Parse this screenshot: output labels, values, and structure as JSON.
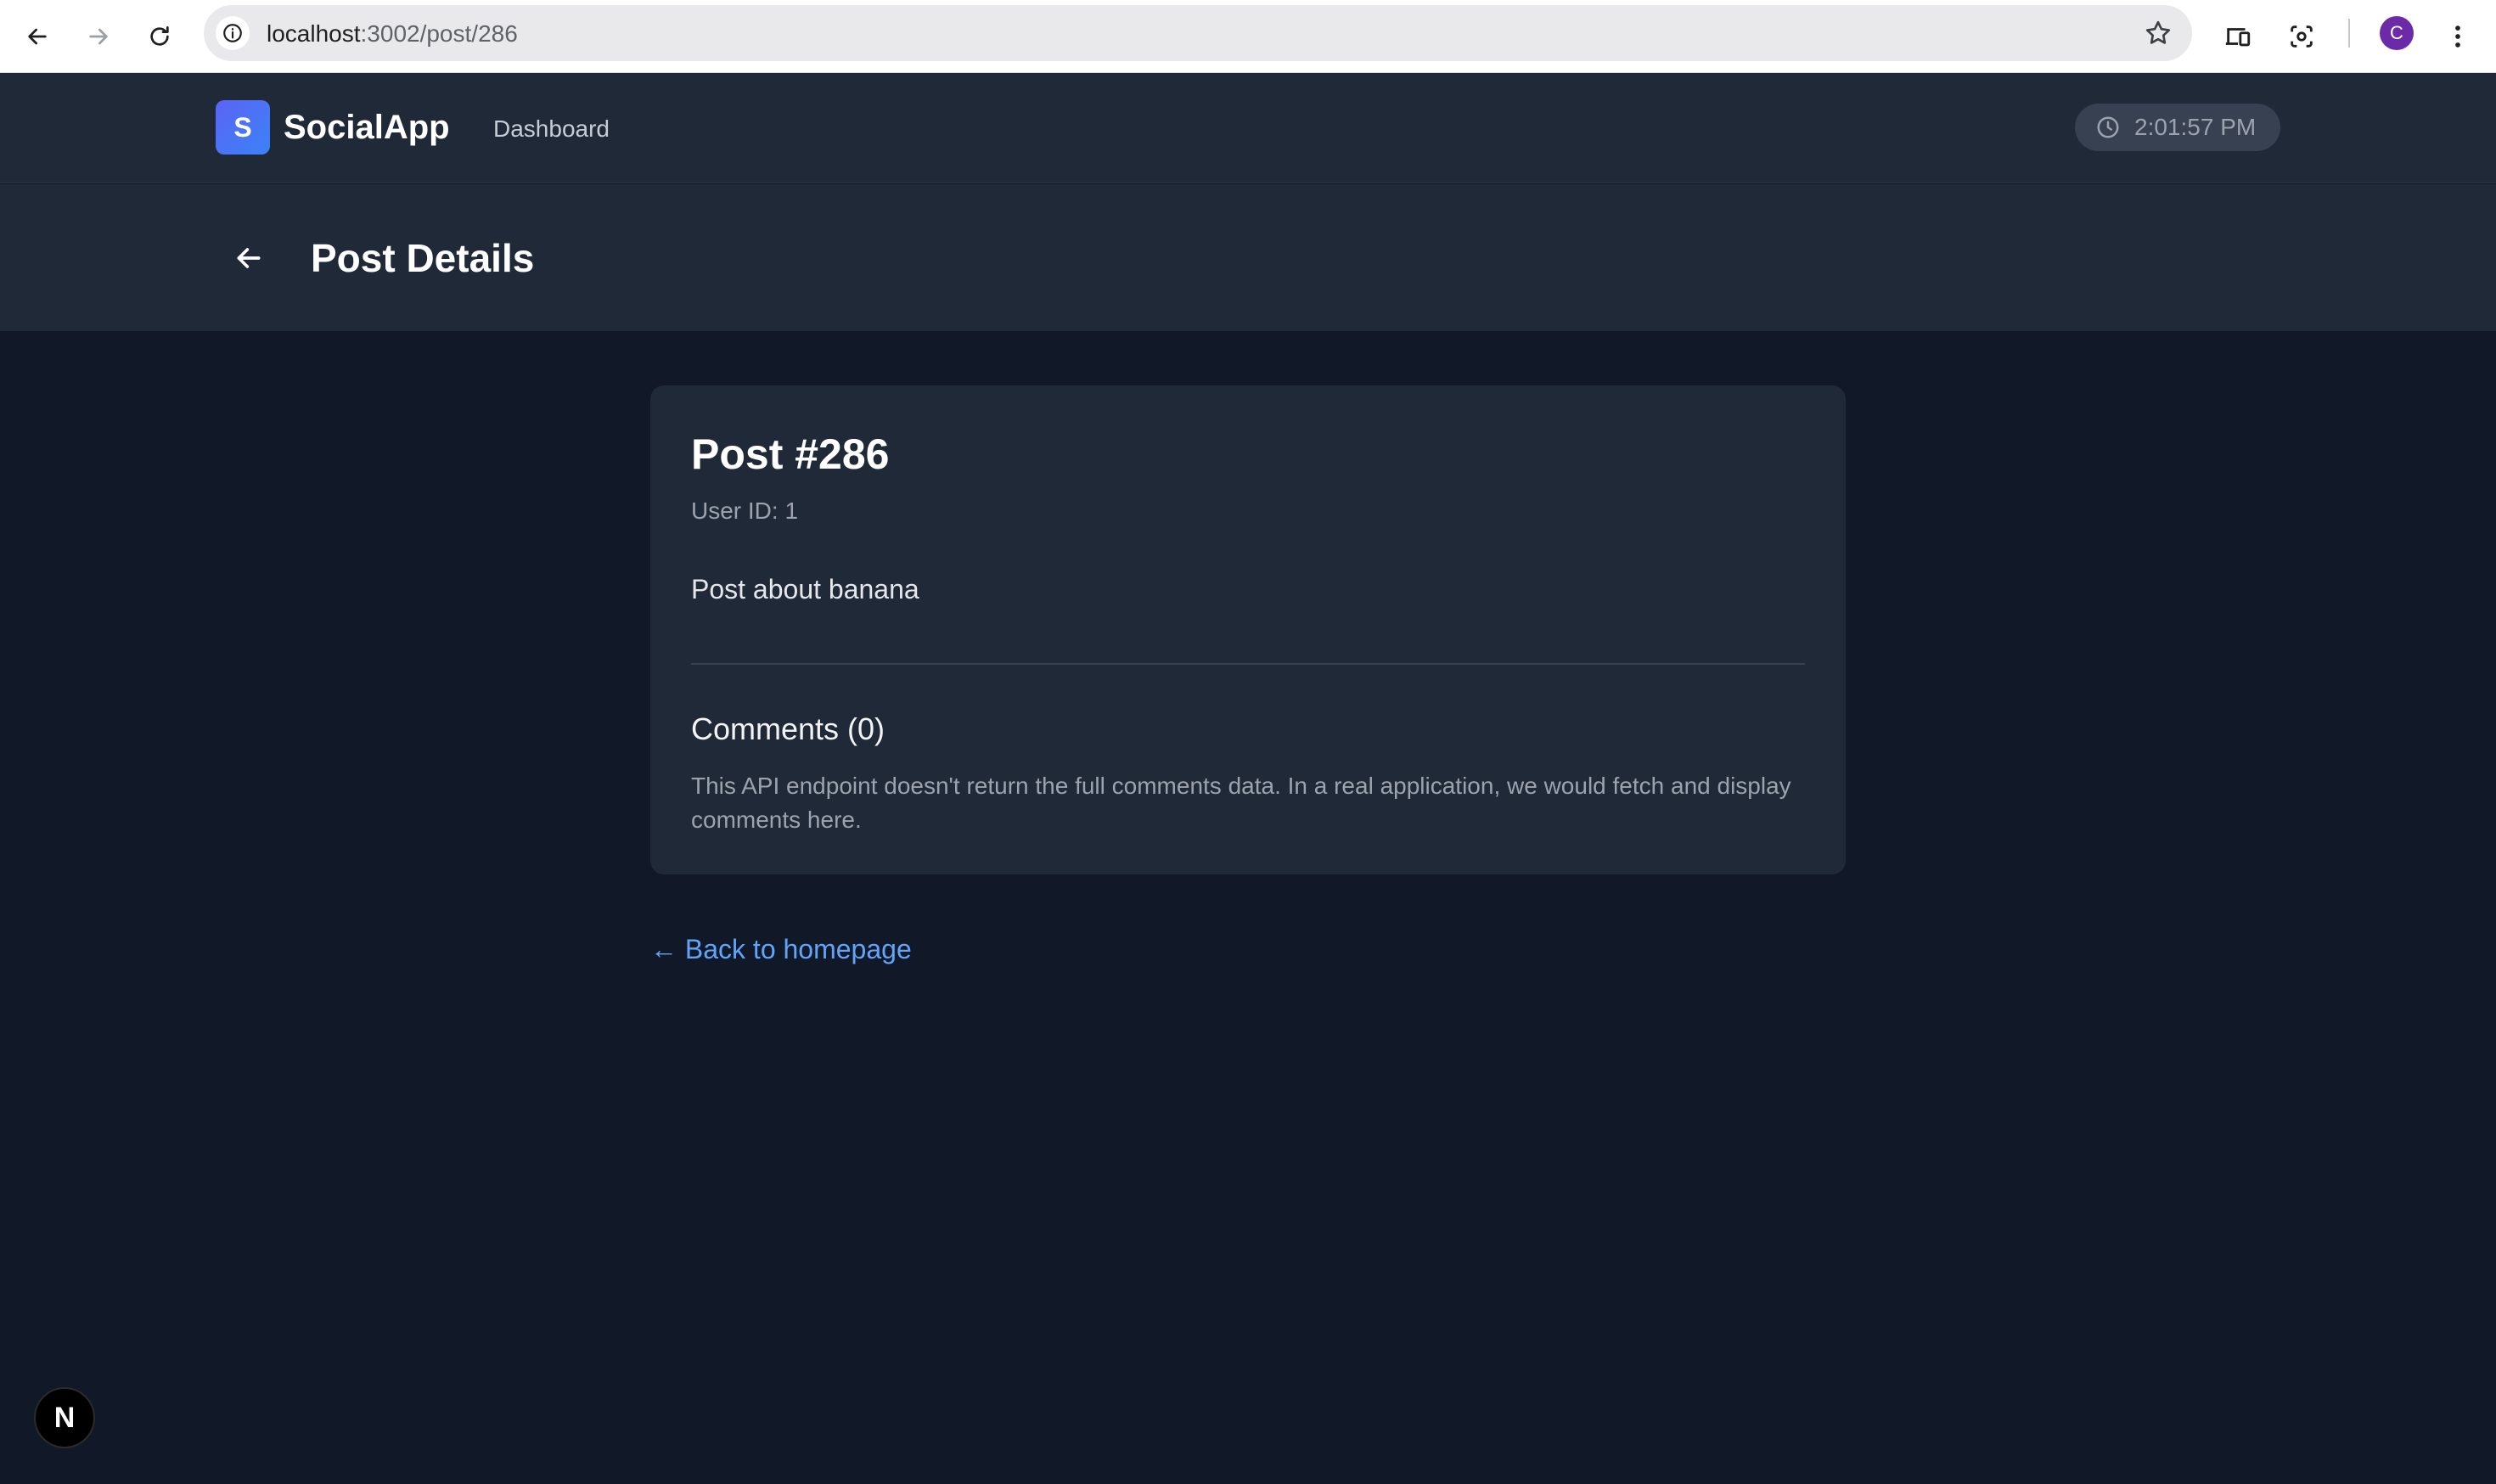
{
  "browser": {
    "url_host": "localhost",
    "url_path": ":3002/post/286",
    "profile_initial": "C"
  },
  "header": {
    "logo_letter": "S",
    "app_name": "SocialApp",
    "nav_link": "Dashboard",
    "clock": "2:01:57 PM"
  },
  "title_bar": {
    "title": "Post Details"
  },
  "post": {
    "title": "Post #286",
    "user_id": "User ID: 1",
    "body": "Post about banana",
    "comments_title": "Comments (0)",
    "comments_note": "This API endpoint doesn't return the full comments data. In a real application, we would fetch and display comments here."
  },
  "back_link": "← Back to homepage",
  "next_badge": "N",
  "colors": {
    "background": "#111827",
    "surface": "#1f2937",
    "accent_link": "#60a5fa",
    "logo_gradient_start": "#5b64f5",
    "logo_gradient_end": "#3b82f6",
    "avatar": "#6b2aa8"
  }
}
